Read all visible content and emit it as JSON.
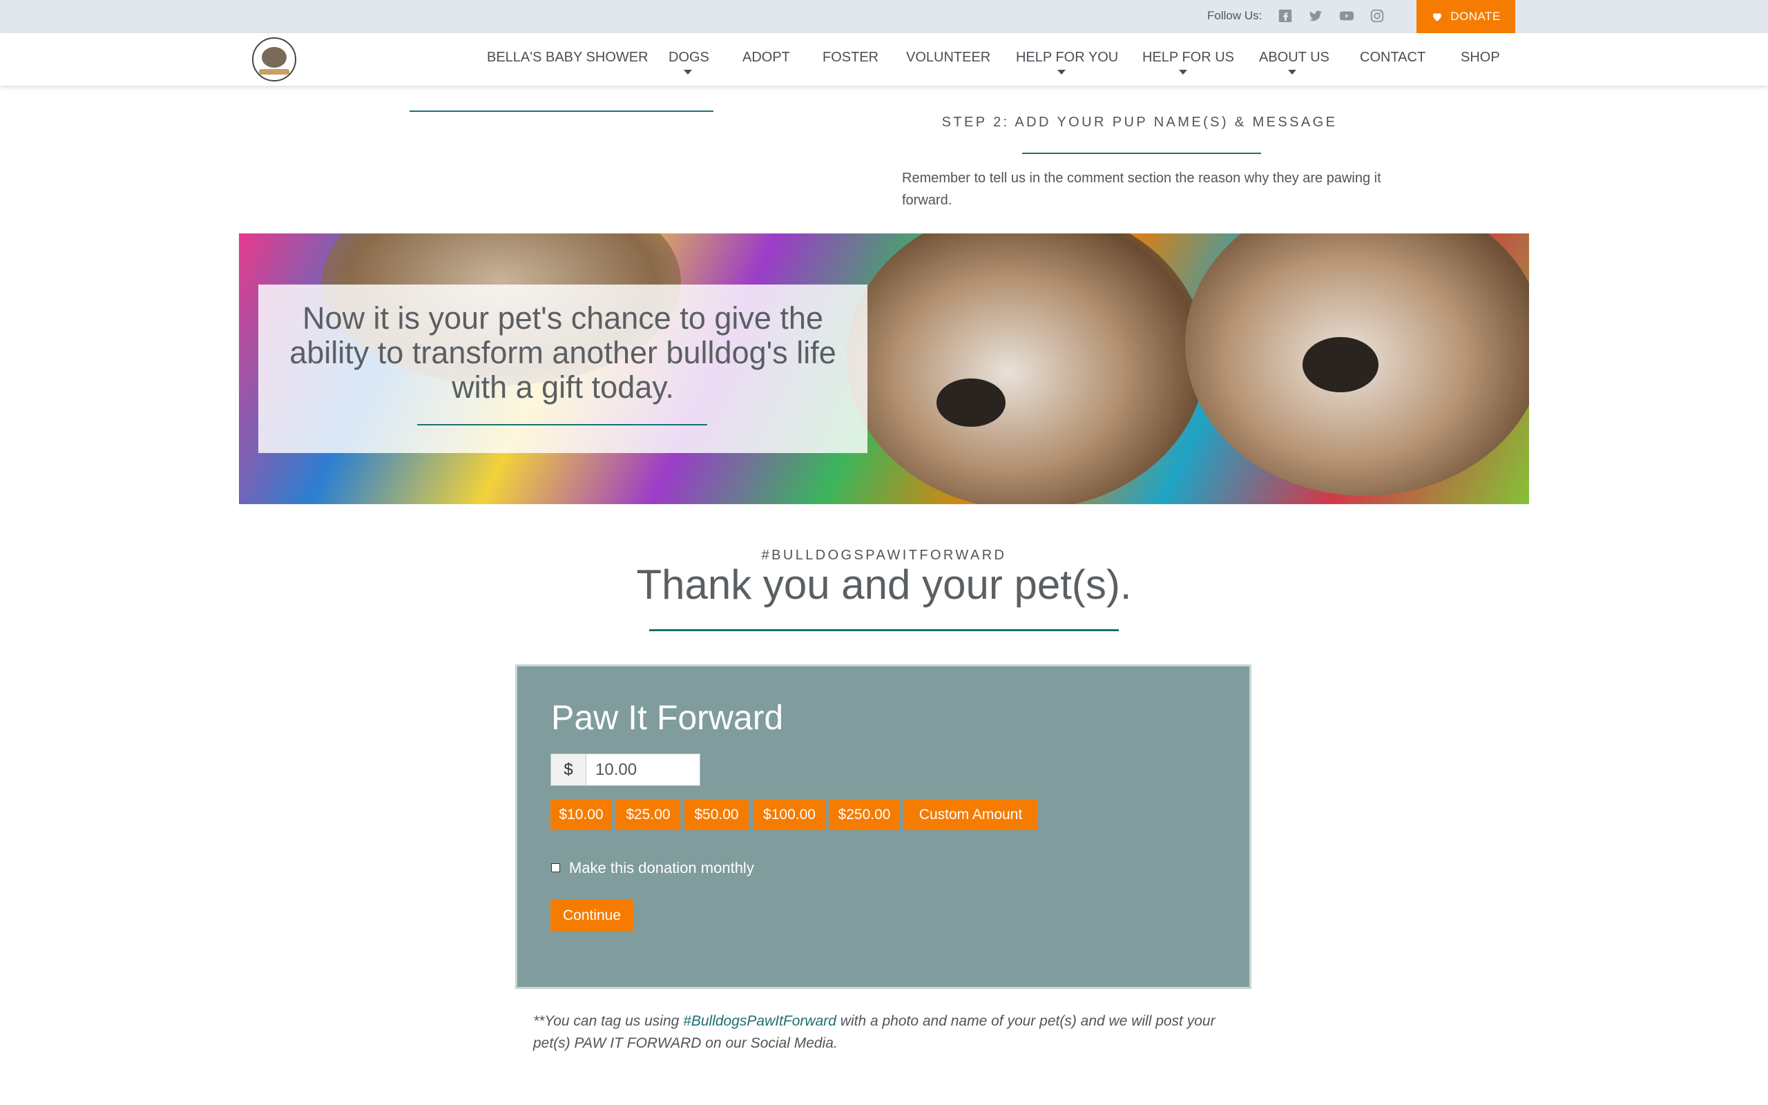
{
  "topbar": {
    "follow_label": "Follow Us:",
    "social_icons": [
      "facebook-icon",
      "twitter-icon",
      "youtube-icon",
      "instagram-icon"
    ],
    "donate_label": "DONATE"
  },
  "nav": {
    "items": [
      {
        "label": "BELLA'S BABY SHOWER",
        "dropdown": false
      },
      {
        "label": "DOGS",
        "dropdown": true
      },
      {
        "label": "ADOPT",
        "dropdown": false
      },
      {
        "label": "FOSTER",
        "dropdown": false
      },
      {
        "label": "VOLUNTEER",
        "dropdown": false
      },
      {
        "label": "HELP FOR YOU",
        "dropdown": true
      },
      {
        "label": "HELP FOR US",
        "dropdown": true
      },
      {
        "label": "ABOUT US",
        "dropdown": true
      },
      {
        "label": "CONTACT",
        "dropdown": false
      },
      {
        "label": "SHOP",
        "dropdown": false
      }
    ]
  },
  "step2": {
    "heading": "STEP 2: ADD YOUR PUP NAME(S) & MESSAGE",
    "text": "Remember to tell us in the comment section the reason why they are pawing it forward."
  },
  "banner": {
    "text": "Now it is your pet's chance to give the ability to transform another bulldog's life with a gift today."
  },
  "thanks": {
    "hashtag": "#BULLDOGSPAWITFORWARD",
    "heading": "Thank you and your pet(s)."
  },
  "form": {
    "title": "Paw It Forward",
    "currency": "$",
    "amount_value": "10.00",
    "amount_buttons": [
      "$10.00",
      "$25.00",
      "$50.00",
      "$100.00",
      "$250.00",
      "Custom Amount"
    ],
    "monthly_label": "Make this donation monthly",
    "monthly_checked": false,
    "continue_label": "Continue"
  },
  "footnote": {
    "prefix": "**You can tag us using ",
    "tag": "#BulldogsPawItForward",
    "suffix": " with a photo and name of your pet(s) and we will post your pet(s) PAW IT FORWARD on our Social Media."
  },
  "colors": {
    "accent": "#f57c00",
    "teal": "#1d6e74",
    "form_bg": "#809c9c",
    "topbar_bg": "#e0e8ee"
  }
}
